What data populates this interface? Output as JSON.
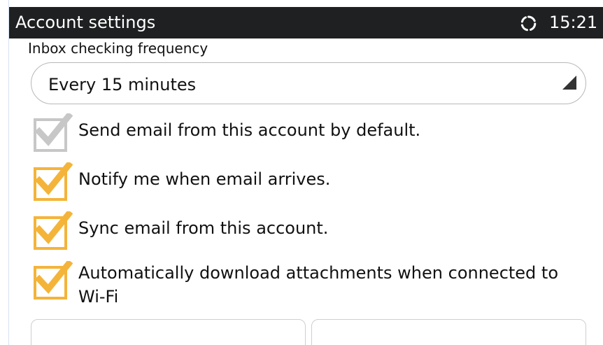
{
  "title_bar": {
    "title": "Account settings",
    "time": "15:21",
    "sync_icon": "sync-icon"
  },
  "inbox": {
    "label": "Inbox checking frequency",
    "selected": "Every 15 minutes"
  },
  "options": [
    {
      "label": "Send email from this account by default.",
      "checked": true,
      "disabled": true
    },
    {
      "label": "Notify me when email arrives.",
      "checked": true,
      "disabled": false
    },
    {
      "label": "Sync email from this account.",
      "checked": true,
      "disabled": false
    },
    {
      "label": "Automatically download attachments when connected to Wi-Fi",
      "checked": true,
      "disabled": false
    }
  ],
  "colors": {
    "title_bar": "#1f2021",
    "checkbox_active": "#f4b43a",
    "checkbox_disabled": "#c7c7c7",
    "text": "#111111"
  }
}
